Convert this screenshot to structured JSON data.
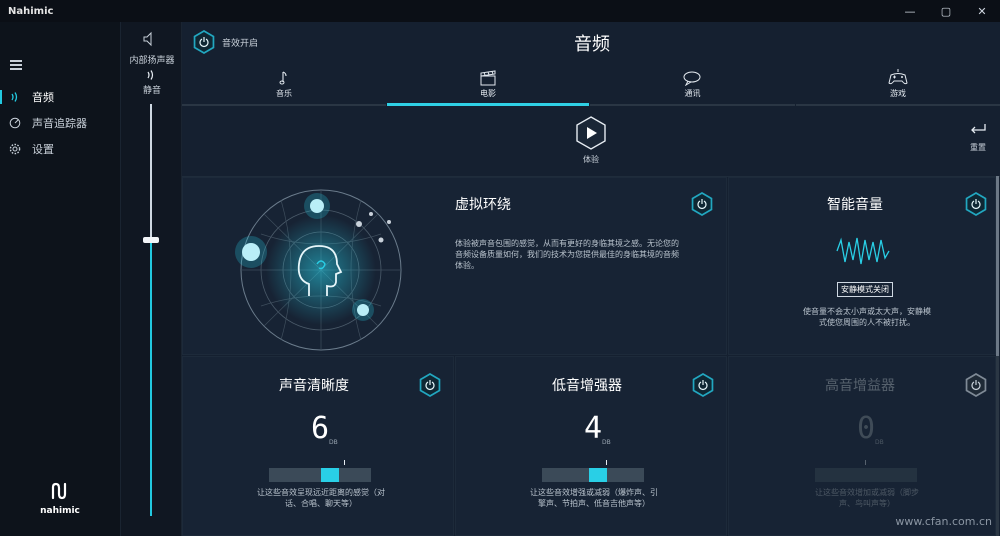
{
  "app": {
    "title": "Nahimic"
  },
  "window_controls": {
    "minimize": "—",
    "maximize": "▢",
    "close": "✕"
  },
  "nav": {
    "items": [
      {
        "label": "音频",
        "icon": "audio-wave-icon",
        "active": true
      },
      {
        "label": "声音追踪器",
        "icon": "radar-icon",
        "active": false
      },
      {
        "label": "设置",
        "icon": "gear-icon",
        "active": false
      }
    ]
  },
  "brand": {
    "name": "nahimic"
  },
  "output": {
    "device_label": "内部扬声器",
    "mute_label": "静音",
    "volume_fraction": 0.67
  },
  "header": {
    "effect_label": "音效开启",
    "title": "音频"
  },
  "tabs": [
    {
      "label": "音乐",
      "icon": "music-note-icon",
      "active": false
    },
    {
      "label": "电影",
      "icon": "clapperboard-icon",
      "active": true
    },
    {
      "label": "通讯",
      "icon": "chat-bubble-icon",
      "active": false
    },
    {
      "label": "游戏",
      "icon": "gamepad-icon",
      "active": false
    }
  ],
  "controls": {
    "play_label": "体验",
    "reset_label": "重置"
  },
  "cards": {
    "surround": {
      "title": "虚拟环绕",
      "desc_line1": "体验被声音包围的感觉，从而有更好的身临其境之感。无论您的",
      "desc_line2": "音频设备质量如何，我们的技术为您提供最佳的身临其境的音频",
      "desc_line3": "体验。",
      "enabled": true
    },
    "smart_volume": {
      "title": "智能音量",
      "quiet_mode": "安静模式关闭",
      "desc_line1": "使音量不会太小声或太大声，安静模",
      "desc_line2": "式使您周围的人不被打扰。",
      "enabled": true
    },
    "clarity": {
      "title": "声音清晰度",
      "value": "6",
      "unit": "DB",
      "level": 0.6,
      "desc_line1": "让这些音效呈现远近距离的感觉（对",
      "desc_line2": "话、合唱、聊天等）",
      "enabled": true
    },
    "bass": {
      "title": "低音增强器",
      "value": "4",
      "unit": "DB",
      "level": 0.55,
      "desc_line1": "让这些音效增强或减弱（爆炸声、引",
      "desc_line2": "擎声、节拍声、低音吉他声等）",
      "enabled": true
    },
    "treble": {
      "title": "高音增益器",
      "value": "0",
      "unit": "DB",
      "level": 0.5,
      "desc_line1": "让这些音效增加或减弱（脚步",
      "desc_line2": "声、鸟叫声等）",
      "enabled": false
    }
  },
  "watermark": "www.cfan.com.cn",
  "colors": {
    "accent": "#22c9e0",
    "bg": "#152030",
    "nav_bg": "#0d131b"
  }
}
